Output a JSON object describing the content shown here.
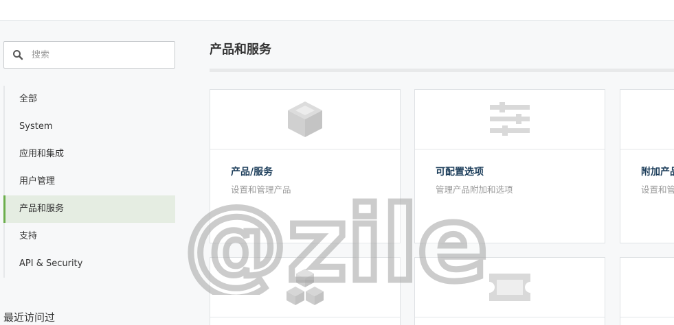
{
  "search": {
    "placeholder": "搜索"
  },
  "sidebar": {
    "items": [
      {
        "label": "全部"
      },
      {
        "label": "System"
      },
      {
        "label": "应用和集成"
      },
      {
        "label": "用户管理"
      },
      {
        "label": "产品和服务",
        "active": true
      },
      {
        "label": "支持"
      },
      {
        "label": "API & Security"
      }
    ],
    "recent_title": "最近访问过"
  },
  "main": {
    "title": "产品和服务",
    "cards": [
      {
        "icon": "box-icon",
        "title": "产品/服务",
        "desc": "设置和管理产品"
      },
      {
        "icon": "sliders-icon",
        "title": "可配置选项",
        "desc": "管理产品附加和选项"
      },
      {
        "icon": "addon-icon",
        "title": "附加产品",
        "desc": "设置和管"
      },
      {
        "icon": "boxes-icon",
        "title": "",
        "desc": ""
      },
      {
        "icon": "ticket-icon",
        "title": "",
        "desc": ""
      },
      {
        "icon": "",
        "title": "",
        "desc": ""
      }
    ]
  },
  "watermark": {
    "text": "@zile"
  },
  "colors": {
    "accent": "#6cae4c",
    "active_bg": "#e5ede2",
    "card_title": "#1c3d5a",
    "icon_gray": "#d9d9d9"
  }
}
